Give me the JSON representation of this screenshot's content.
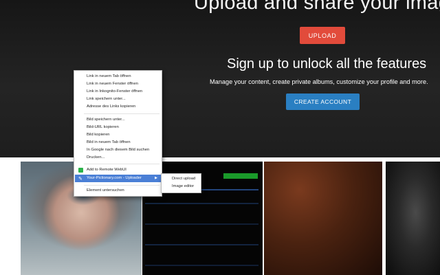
{
  "hero": {
    "title": "Upload and share your image",
    "upload_label": "UPLOAD",
    "signup_heading": "Sign up to unlock all the features",
    "signup_description": "Manage your content, create private albums, customize your profile and more.",
    "create_account_label": "CREATE ACCOUNT"
  },
  "context_menu": {
    "items": [
      "Link in neuem Tab öffnen",
      "Link in neuem Fenster öffnen",
      "Link in Inkognito-Fenster öffnen",
      "Link speichern unter...",
      "Adresse des Links kopieren",
      "Bild speichern unter...",
      "Bild-URL kopieren",
      "Bild kopieren",
      "Bild in neuem Tab öffnen",
      "In Google nach diesem Bild suchen",
      "Drucken...",
      "Add to Remote WebUI",
      "Your-Pictionary.com - Uploader",
      "Element untersuchen"
    ],
    "highlighted_item": "Your-Pictionary.com - Uploader",
    "submenu": [
      "Direct upload",
      "Image editor"
    ]
  },
  "gallery": {
    "thumbnails": [
      "girl-portrait",
      "terminal-screenshot",
      "dark-texture",
      "spider-man"
    ]
  },
  "colors": {
    "upload_button": "#e24b3b",
    "create_account_button": "#2a7fc2",
    "menu_highlight": "#4a7fd6"
  }
}
